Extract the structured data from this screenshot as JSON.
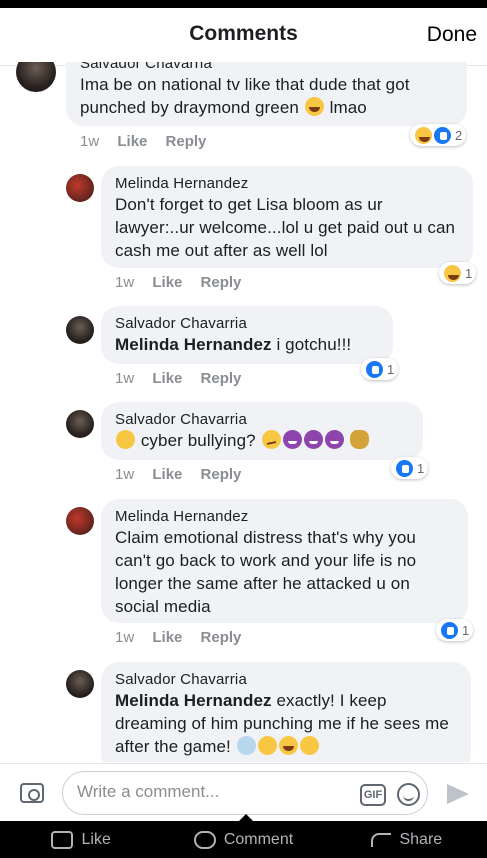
{
  "header": {
    "title": "Comments",
    "done_label": "Done"
  },
  "comments": [
    {
      "author": "Salvador Chavarria",
      "text": "Ima be on national tv like that dude that got punched by draymond green",
      "trail": " lmao",
      "time": "1w",
      "like": "Like",
      "reply": "Reply",
      "reaction_count": "2",
      "reactions": [
        "haha",
        "like"
      ]
    },
    {
      "author": "Melinda Hernandez",
      "text": "Don't forget to get Lisa bloom as ur lawyer:..ur welcome...lol u get paid out u can cash me out after as well lol",
      "time": "1w",
      "like": "Like",
      "reply": "Reply",
      "reaction_count": "1",
      "reactions": [
        "haha"
      ]
    },
    {
      "author": "Salvador Chavarria",
      "mention": "Melinda Hernandez",
      "text": " i gotchu!!!",
      "time": "1w",
      "like": "Like",
      "reply": "Reply",
      "reaction_count": "1",
      "reactions": [
        "like"
      ]
    },
    {
      "author": "Salvador Chavarria",
      "text": " cyber bullying? ",
      "time": "1w",
      "like": "Like",
      "reply": "Reply",
      "reaction_count": "1",
      "reactions": [
        "like"
      ]
    },
    {
      "author": "Melinda Hernandez",
      "text": "Claim emotional distress that's why you can't go back to work and your life is no longer the same after he attacked u on social media",
      "time": "1w",
      "like": "Like",
      "reply": "Reply",
      "reaction_count": "1",
      "reactions": [
        "like"
      ]
    },
    {
      "author": "Salvador Chavarria",
      "mention": "Melinda Hernandez",
      "text": " exactly! I keep dreaming of him punching me if he sees me after the game! "
    }
  ],
  "composer": {
    "placeholder": "Write a comment...",
    "gif_label": "GIF"
  },
  "bottom_bar": {
    "like": "Like",
    "comment": "Comment",
    "share": "Share"
  },
  "icons": [
    "camera-icon",
    "gif-icon",
    "emoji-icon",
    "send-icon",
    "like-icon",
    "comment-icon",
    "share-icon"
  ],
  "colors": {
    "bubble": "#f0f2f5",
    "link_blue": "#1877f2",
    "meta_gray": "#8a8d91"
  }
}
